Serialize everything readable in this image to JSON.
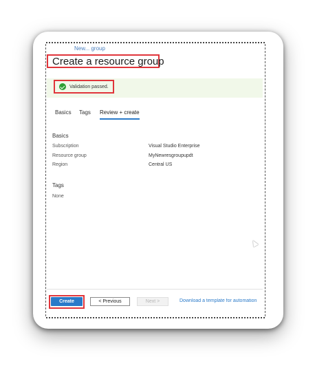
{
  "breadcrumb": "New... group",
  "title": "Create a resource group",
  "validation": {
    "text": "Validation passed.",
    "icon": "check-circle-icon",
    "color": "#2e9e34"
  },
  "tabs": [
    {
      "label": "Basics",
      "active": false
    },
    {
      "label": "Tags",
      "active": false
    },
    {
      "label": "Review + create",
      "active": true
    }
  ],
  "basics": {
    "heading": "Basics",
    "rows": [
      {
        "label": "Subscription",
        "value": "Visual Studio Enterprise"
      },
      {
        "label": "Resource group",
        "value": "MyNewresgroupupdt"
      },
      {
        "label": "Region",
        "value": "Central US"
      }
    ]
  },
  "tags": {
    "heading": "Tags",
    "value": "None"
  },
  "footer": {
    "create": "Create",
    "previous": "< Previous",
    "next": "Next >",
    "download": "Download a template for automation"
  },
  "colors": {
    "accent": "#2a7ac9",
    "highlight": "#e0343a",
    "success_bg": "#f1f8e9"
  }
}
